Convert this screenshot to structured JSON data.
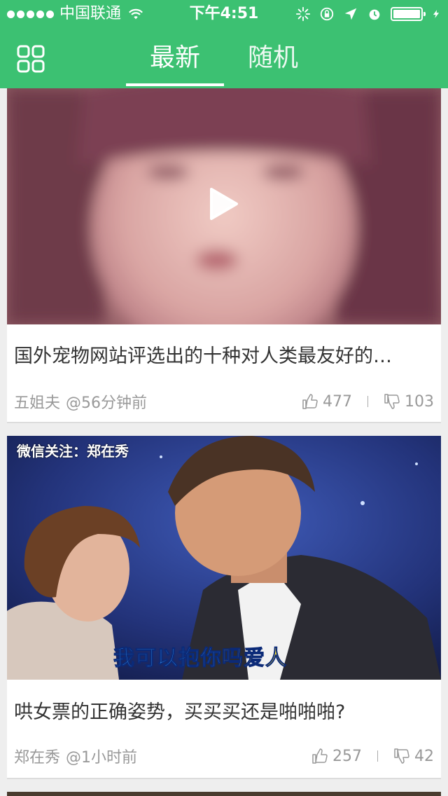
{
  "status_bar": {
    "carrier": "中国联通",
    "time": "下午4:51",
    "battery_level": 1.0
  },
  "nav": {
    "tabs": [
      {
        "label": "最新",
        "active": true
      },
      {
        "label": "随机",
        "active": false
      }
    ]
  },
  "colors": {
    "brand_green": "#3cc172",
    "card_bg": "#ffffff",
    "page_bg": "#eeeeee",
    "meta_gray": "#999999"
  },
  "feed": {
    "items": [
      {
        "title": "国外宠物网站评选出的十种对人类最友好的…",
        "author": "五姐夫",
        "time": "@56分钟前",
        "likes": "477",
        "dislikes": "103",
        "has_play_icon": true
      },
      {
        "title": "哄女票的正确姿势，买买买还是啪啪啪?",
        "author": "郑在秀",
        "time": "@1小时前",
        "likes": "257",
        "dislikes": "42",
        "overlay_text": "微信关注：郑在秀",
        "subtitle_blue": "我可以抱你",
        "subtitle_yellow": "吗爱人"
      }
    ]
  }
}
